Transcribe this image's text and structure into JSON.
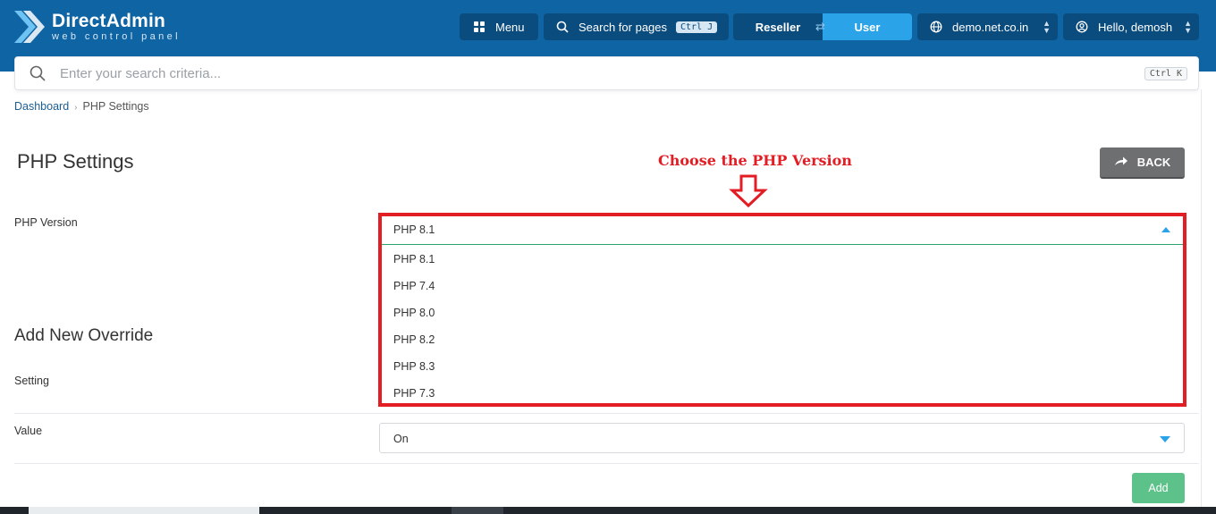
{
  "brand": {
    "name": "DirectAdmin",
    "tagline": "web control panel"
  },
  "topbar": {
    "menu_label": "Menu",
    "search_label": "Search for pages",
    "search_shortcut": "Ctrl J",
    "switch": {
      "left": "Reseller",
      "right": "User",
      "active": "User"
    },
    "domain": "demo.net.co.in",
    "greeting": "Hello, demosh"
  },
  "search": {
    "placeholder": "Enter your search criteria...",
    "shortcut": "Ctrl K"
  },
  "breadcrumb": {
    "items": [
      "Dashboard",
      "PHP Settings"
    ]
  },
  "page": {
    "title": "PHP Settings",
    "back_label": "BACK"
  },
  "annotation": {
    "text": "Choose the PHP Version"
  },
  "php_version": {
    "label": "PHP Version",
    "selected": "PHP 8.1",
    "options": [
      "PHP 8.1",
      "PHP 7.4",
      "PHP 8.0",
      "PHP 8.2",
      "PHP 8.3",
      "PHP 7.3"
    ]
  },
  "override": {
    "title": "Add New Override",
    "setting_label": "Setting",
    "value_label": "Value",
    "value_selected": "On",
    "add_label": "Add"
  },
  "colors": {
    "topbar": "#0f64a4",
    "accent": "#2ba3e8",
    "annotation": "#e21d23",
    "add_button": "#5dc28a",
    "back_button": "#6d6f71"
  }
}
